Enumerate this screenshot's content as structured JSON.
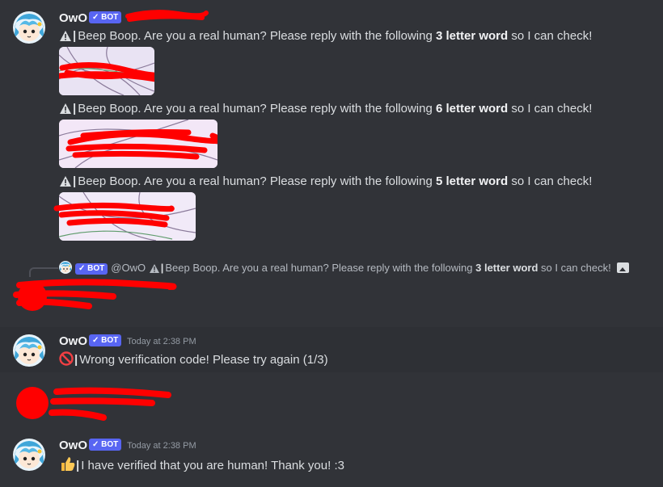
{
  "bot": {
    "name": "OwO",
    "badge": "BOT",
    "check": "✓"
  },
  "messages": {
    "captcha1": {
      "prefix": "Beep Boop. Are you a real human? Please reply with the following ",
      "bold": "3 letter word",
      "suffix": " so I can check!"
    },
    "captcha2": {
      "prefix": "Beep Boop. Are you a real human? Please reply with the following ",
      "bold": "6 letter word",
      "suffix": " so I can check!"
    },
    "captcha3": {
      "prefix": "Beep Boop. Are you a real human? Please reply with the following ",
      "bold": "5 letter word",
      "suffix": " so I can check!"
    },
    "reply": {
      "mention": "@OwO",
      "prefix": "Beep Boop. Are you a real human? Please reply with the following ",
      "bold": "3 letter word",
      "suffix": " so I can check!"
    },
    "wrong": {
      "timestamp": "Today at 2:38 PM",
      "text": "Wrong verification code! Please try again (1/3)"
    },
    "verified": {
      "timestamp": "Today at 2:38 PM",
      "text": "I have verified that you are human! Thank you! :3"
    }
  },
  "icons": {
    "warning": "warning-icon",
    "prohibited": "prohibited-icon",
    "thumbs_up": "thumbs-up-icon",
    "image": "image-icon"
  },
  "colors": {
    "background": "#313338",
    "bot_badge": "#5865f2",
    "redaction": "#ff0000",
    "username": "#f2f3f5"
  }
}
